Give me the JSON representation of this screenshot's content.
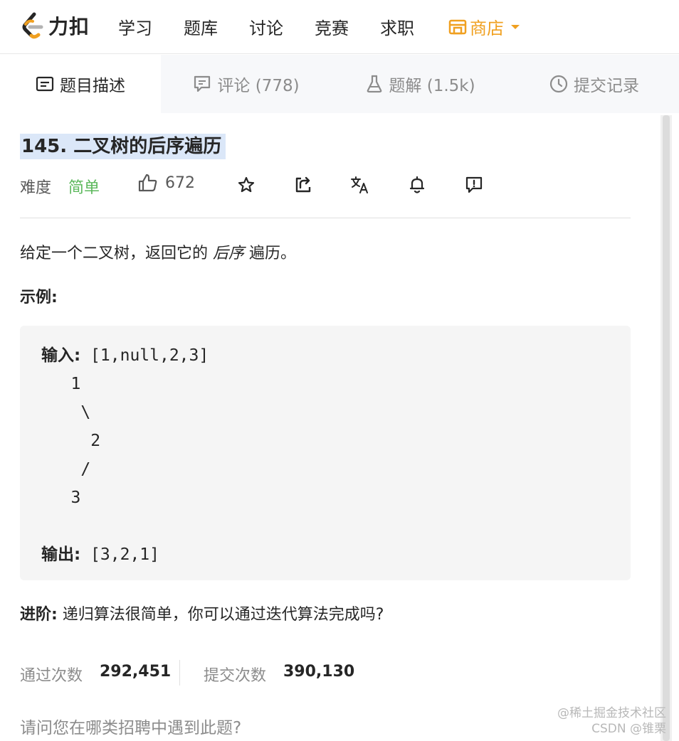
{
  "brand": {
    "name": "力扣"
  },
  "nav": {
    "items": [
      "学习",
      "题库",
      "讨论",
      "竞赛",
      "求职"
    ],
    "store_label": "商店",
    "store_color": "#f0a020"
  },
  "tabs": [
    {
      "label": "题目描述",
      "icon": "description-icon",
      "active": true
    },
    {
      "label": "评论 (778)",
      "icon": "comment-icon"
    },
    {
      "label": "题解 (1.5k)",
      "icon": "flask-icon"
    },
    {
      "label": "提交记录",
      "icon": "clock-icon"
    }
  ],
  "problem": {
    "title": "145. 二叉树的后序遍历",
    "difficulty_label": "难度",
    "difficulty": "简单",
    "difficulty_color": "#5cb85c",
    "likes": "672",
    "description_before": "给定一个二叉树，返回它的 ",
    "description_em": "后序",
    "description_after": " 遍历。",
    "example_label": "示例:",
    "example": {
      "input_label": "输入:",
      "input_value": " [1,null,2,3]",
      "tree_lines": [
        "   1",
        "    \\",
        "     2",
        "    /",
        "   3"
      ],
      "output_label": "输出:",
      "output_value": " [3,2,1]"
    },
    "followup_label": "进阶:",
    "followup_text": " 递归算法很简单，你可以通过迭代算法完成吗?"
  },
  "stats": {
    "accepted_label": "通过次数",
    "accepted_value": "292,451",
    "submissions_label": "提交次数",
    "submissions_value": "390,130"
  },
  "question_prompt": "请问您在哪类招聘中遇到此题?",
  "watermark": {
    "line1": "@稀土掘金技术社区",
    "line2": "CSDN @锥栗"
  }
}
